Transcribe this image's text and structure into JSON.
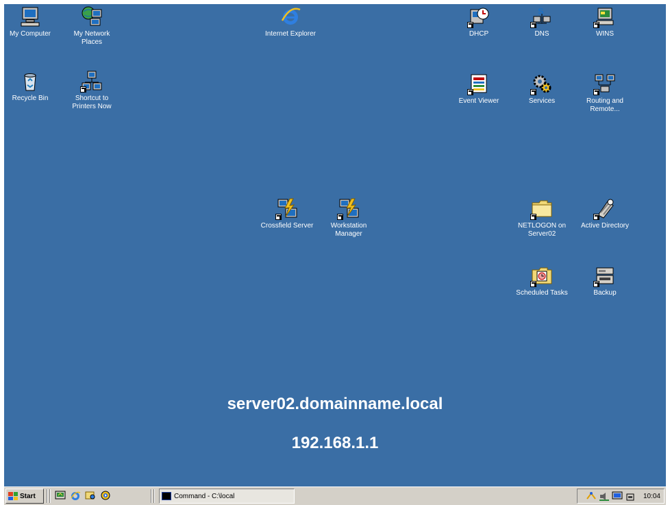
{
  "desktop": {
    "background_color": "#3a6ea5",
    "icons": {
      "my_computer": "My Computer",
      "my_network_places": "My Network Places",
      "recycle_bin": "Recycle Bin",
      "shortcut_to_printers": "Shortcut to Printers Now",
      "internet_explorer": "Internet Explorer",
      "dhcp": "DHCP",
      "dns": "DNS",
      "wins": "WINS",
      "event_viewer": "Event Viewer",
      "services": "Services",
      "routing_and_remote": "Routing and Remote...",
      "crossfield_server": "Crossfield Server",
      "workstation_manager": "Workstation Manager",
      "netlogon": "NETLOGON on Server02",
      "active_directory": "Active Directory",
      "scheduled_tasks": "Scheduled Tasks",
      "backup": "Backup"
    },
    "hostname": "server02.domainname.local",
    "ip_address": "192.168.1.1"
  },
  "taskbar": {
    "start_label": "Start",
    "task_button_label": "Command - C:\\local",
    "clock": "10:04",
    "quick_launch": [
      "desktop-icon",
      "ie-icon",
      "explorer-icon",
      "media-icon"
    ],
    "tray_icons": [
      "network-icon",
      "volume-icon",
      "display-icon",
      "security-icon"
    ]
  }
}
